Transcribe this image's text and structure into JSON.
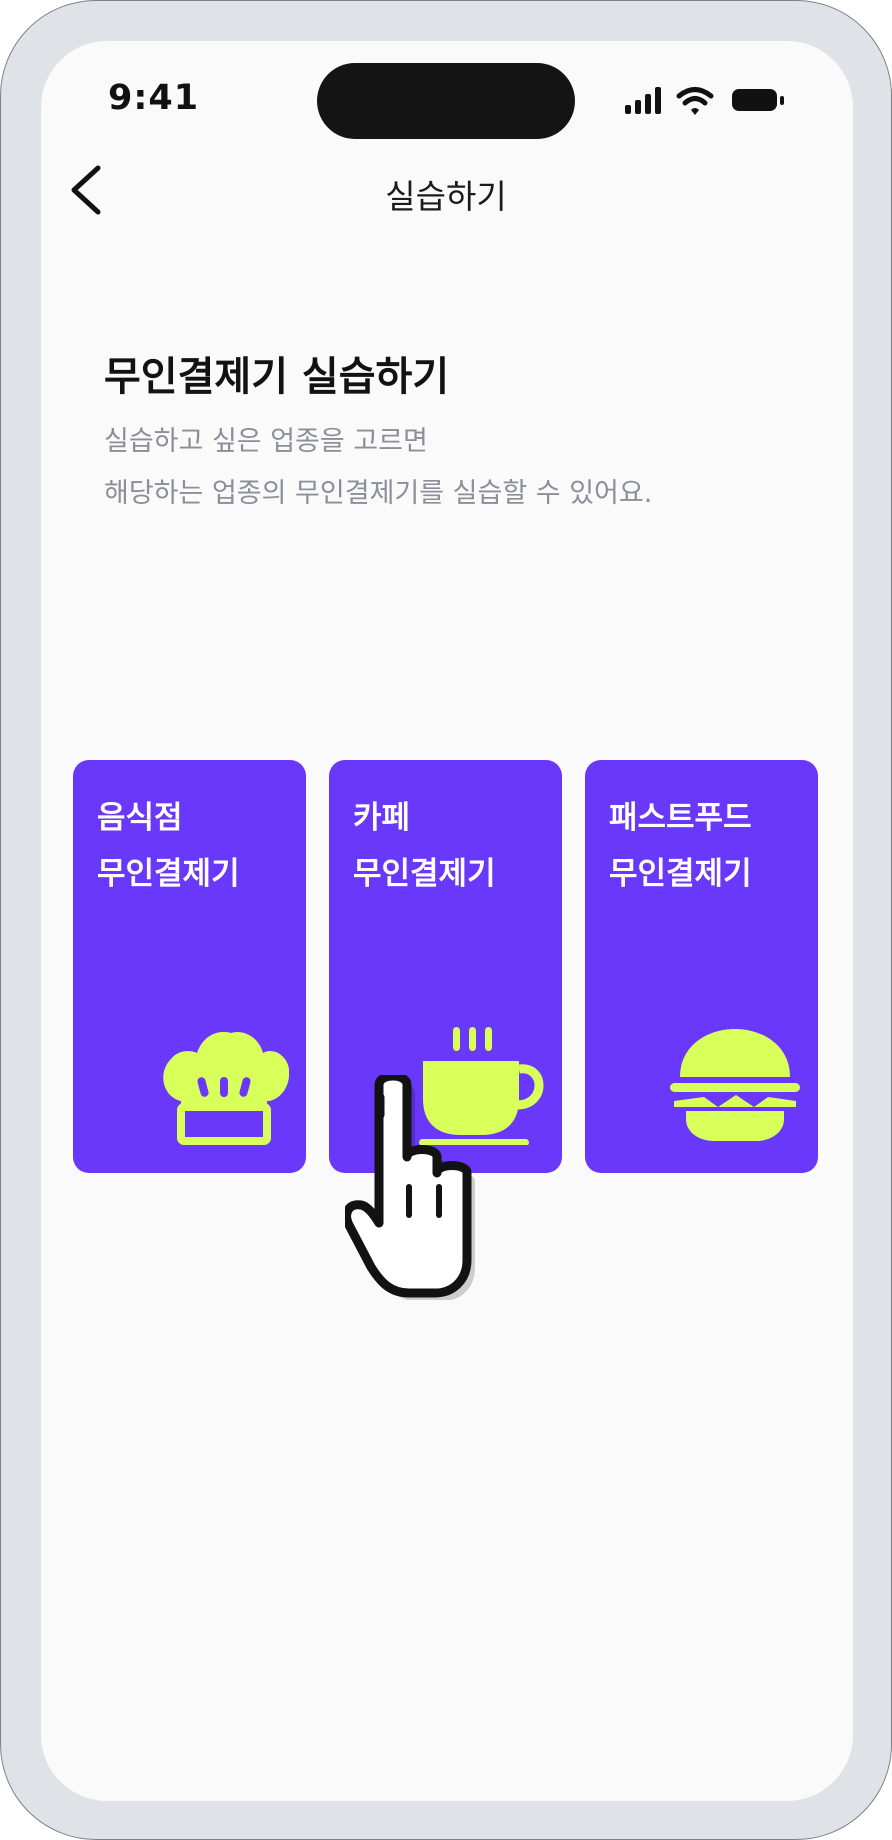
{
  "status_bar": {
    "time": "9:41"
  },
  "nav": {
    "title": "실습하기",
    "back_icon": "chevron-left-icon"
  },
  "intro": {
    "headline": "무인결제기 실습하기",
    "description_line1": "실습하고 싶은 업종을 고르면",
    "description_line2": "해당하는 업종의 무인결제기를 실습할 수 있어요."
  },
  "categories": [
    {
      "line1": "음식점",
      "line2": "무인결제기",
      "icon": "chef-hat-icon"
    },
    {
      "line1": "카페",
      "line2": "무인결제기",
      "icon": "coffee-cup-icon"
    },
    {
      "line1": "패스트푸드",
      "line2": "무인결제기",
      "icon": "burger-icon"
    }
  ],
  "colors": {
    "card_background": "#6938fb",
    "icon_accent": "#d8ff5a",
    "device_frame": "#dfe2e6",
    "screen_background": "#fafafa",
    "description_text": "#8a8f98"
  },
  "overlay": {
    "icon": "pointing-hand-cursor-icon"
  }
}
